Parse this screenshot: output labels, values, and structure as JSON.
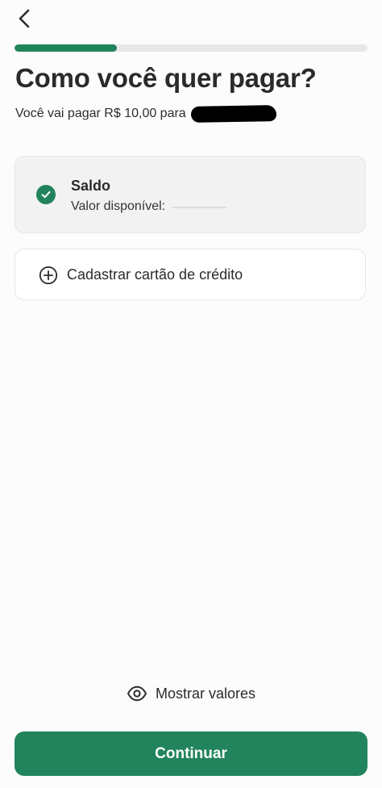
{
  "header": {
    "back_icon": "chevron-left-icon",
    "progress_fraction": 0.29
  },
  "page": {
    "title": "Como você quer pagar?",
    "subtitle": "Você vai pagar R$ 10,00 para"
  },
  "payment_options": {
    "saldo": {
      "title": "Saldo",
      "available_label": "Valor disponível:",
      "selected": true,
      "icon": "check-circle-icon"
    },
    "credit_card": {
      "label": "Cadastrar cartão de crédito",
      "icon": "plus-circle-icon"
    }
  },
  "footer": {
    "show_values_label": "Mostrar valores",
    "show_values_icon": "eye-icon",
    "continue_label": "Continuar"
  },
  "colors": {
    "primary": "#22845d",
    "progress_track": "#e8e8e8",
    "selected_card_bg": "#f2f2f2"
  }
}
